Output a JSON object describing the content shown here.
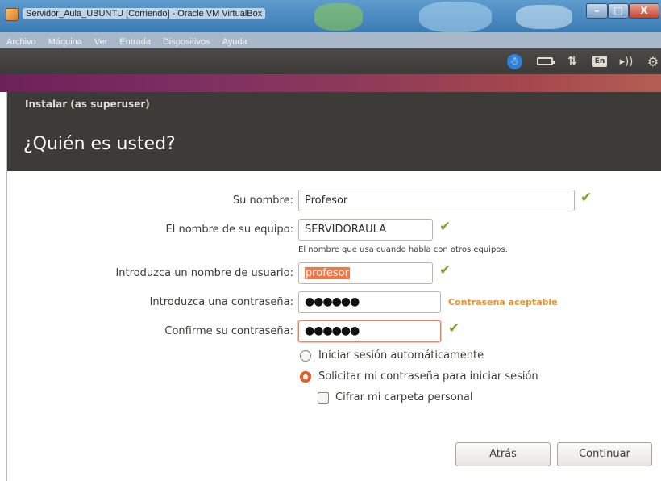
{
  "host_window": {
    "title": "Servidor_Aula_UBUNTU [Corriendo] - Oracle VM VirtualBox",
    "minimize_label": "–",
    "maximize_label": "□",
    "close_label": "X"
  },
  "vbox_menu": [
    "Archivo",
    "Máquina",
    "Ver",
    "Entrada",
    "Dispositivos",
    "Ayuda"
  ],
  "panel": {
    "indicators": [
      "accessibility-icon",
      "battery-icon",
      "network-icon",
      "keyboard-language-icon",
      "volume-icon",
      "settings-icon"
    ],
    "language": "En",
    "accent_color": "#2d7fd3"
  },
  "installer": {
    "window_title": "Instalar (as superuser)",
    "heading": "¿Quién es usted?",
    "fields": {
      "name": {
        "label": "Su nombre:",
        "value": "Profesor",
        "valid": true
      },
      "computer": {
        "label": "El nombre de su equipo:",
        "value": "SERVIDORAULA",
        "hint": "El nombre que usa cuando habla con otros equipos.",
        "valid": true
      },
      "username": {
        "label": "Introduzca un nombre de usuario:",
        "value": "profesor",
        "valid": true
      },
      "password": {
        "label": "Introduzca una contraseña:",
        "value": "●●●●●●",
        "status": "Contraseña aceptable"
      },
      "confirm": {
        "label": "Confirme su contraseña:",
        "value": "●●●●●●",
        "valid": true
      }
    },
    "login_options": {
      "auto_login": {
        "label": "Iniciar sesión automáticamente",
        "selected": false
      },
      "require_password": {
        "label": "Solicitar mi contraseña para iniciar sesión",
        "selected": true
      },
      "encrypt_home": {
        "label": "Cifrar mi carpeta personal",
        "checked": false
      }
    },
    "buttons": {
      "back": "Atrás",
      "continue": "Continuar"
    },
    "colors": {
      "valid_check": "#7aa62e",
      "password_status": "#e8912a",
      "selection": "#f07746",
      "header_bg": "#3c3b37"
    }
  }
}
